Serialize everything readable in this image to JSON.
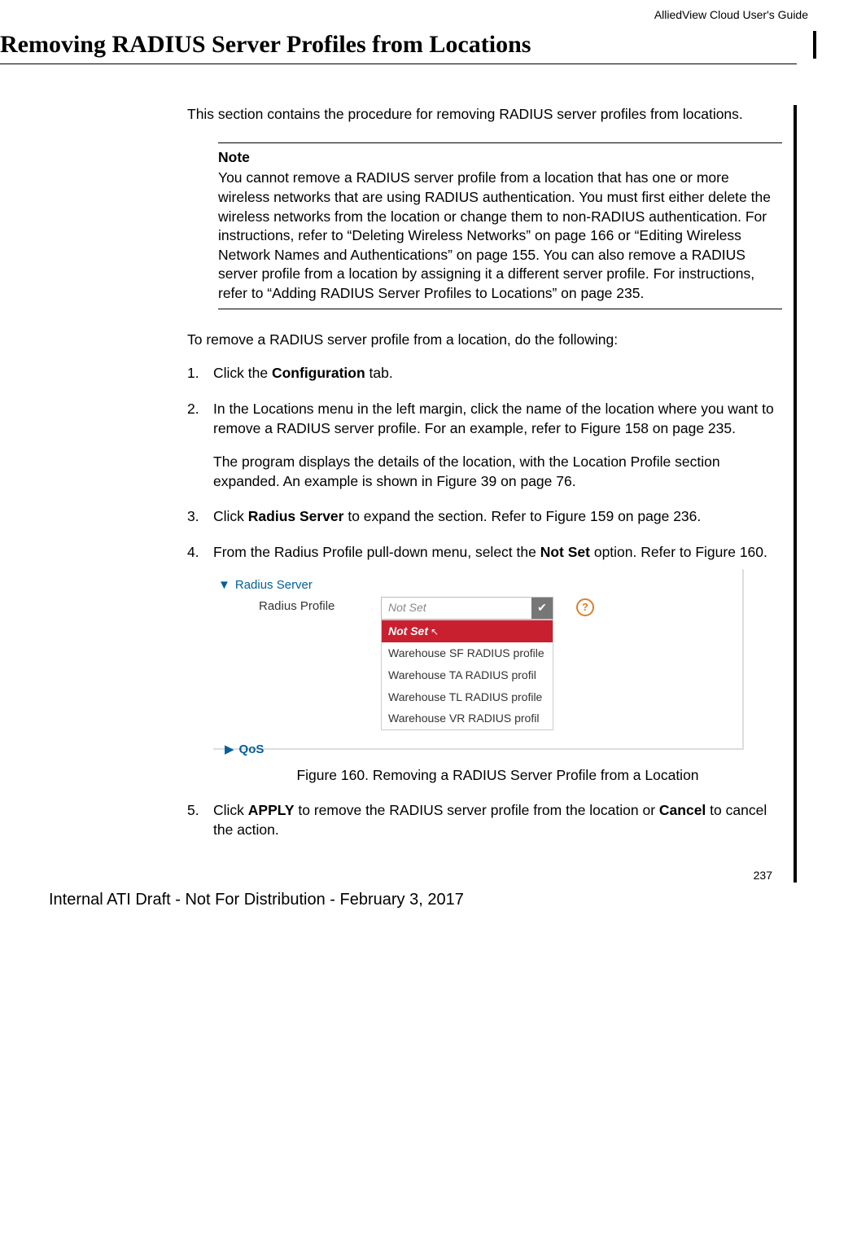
{
  "header": {
    "guide": "AlliedView Cloud User's Guide"
  },
  "title": "Removing RADIUS Server Profiles from Locations",
  "intro": "This section contains the procedure for removing RADIUS server profiles from locations.",
  "note": {
    "label": "Note",
    "text": "You cannot remove a RADIUS server profile from a location that has one or more wireless networks that are using RADIUS authentication. You must first either delete the wireless networks from the location or change them to non-RADIUS authentication. For instructions, refer to “Deleting Wireless Networks” on page 166 or “Editing Wireless Network Names and Authentications” on page 155. You can also remove a RADIUS server profile from a location by assigning it a different server profile. For instructions, refer to “Adding RADIUS Server Profiles to Locations” on page 235."
  },
  "lead_in": "To remove a RADIUS server profile from a location, do the following:",
  "steps": {
    "s1_pre": "Click the ",
    "s1_bold": "Configuration",
    "s1_post": " tab.",
    "s2_a": "In the Locations menu in the left margin, click the name of the location where you want to remove a RADIUS server profile. For an example, refer to Figure 158 on page 235.",
    "s2_b": "The program displays the details of the location, with the Location Profile section expanded. An example is shown in Figure 39 on page 76.",
    "s3_pre": "Click ",
    "s3_bold": "Radius Server",
    "s3_post": " to expand the section. Refer to Figure 159 on page 236.",
    "s4_pre": "From the Radius Profile pull-down menu, select the ",
    "s4_bold": "Not Set",
    "s4_post": " option. Refer to Figure 160.",
    "s5_pre": "Click ",
    "s5_bold1": "APPLY",
    "s5_mid": " to remove the RADIUS server profile from the location or ",
    "s5_bold2": "Cancel",
    "s5_post": " to cancel the action."
  },
  "figure": {
    "expander_radius": "Radius Server",
    "profile_label": "Radius Profile",
    "select_placeholder": "Not Set",
    "options": {
      "selected": "Not Set",
      "o1": "Warehouse SF RADIUS profile",
      "o2": "Warehouse TA RADIUS profil",
      "o3": "Warehouse TL RADIUS profile",
      "o4": "Warehouse VR RADIUS profil"
    },
    "qos": "QoS",
    "caption": "Figure 160. Removing a RADIUS Server Profile from a Location",
    "help": "?"
  },
  "page_number": "237",
  "footer": "Internal ATI Draft - Not For Distribution - February 3, 2017"
}
